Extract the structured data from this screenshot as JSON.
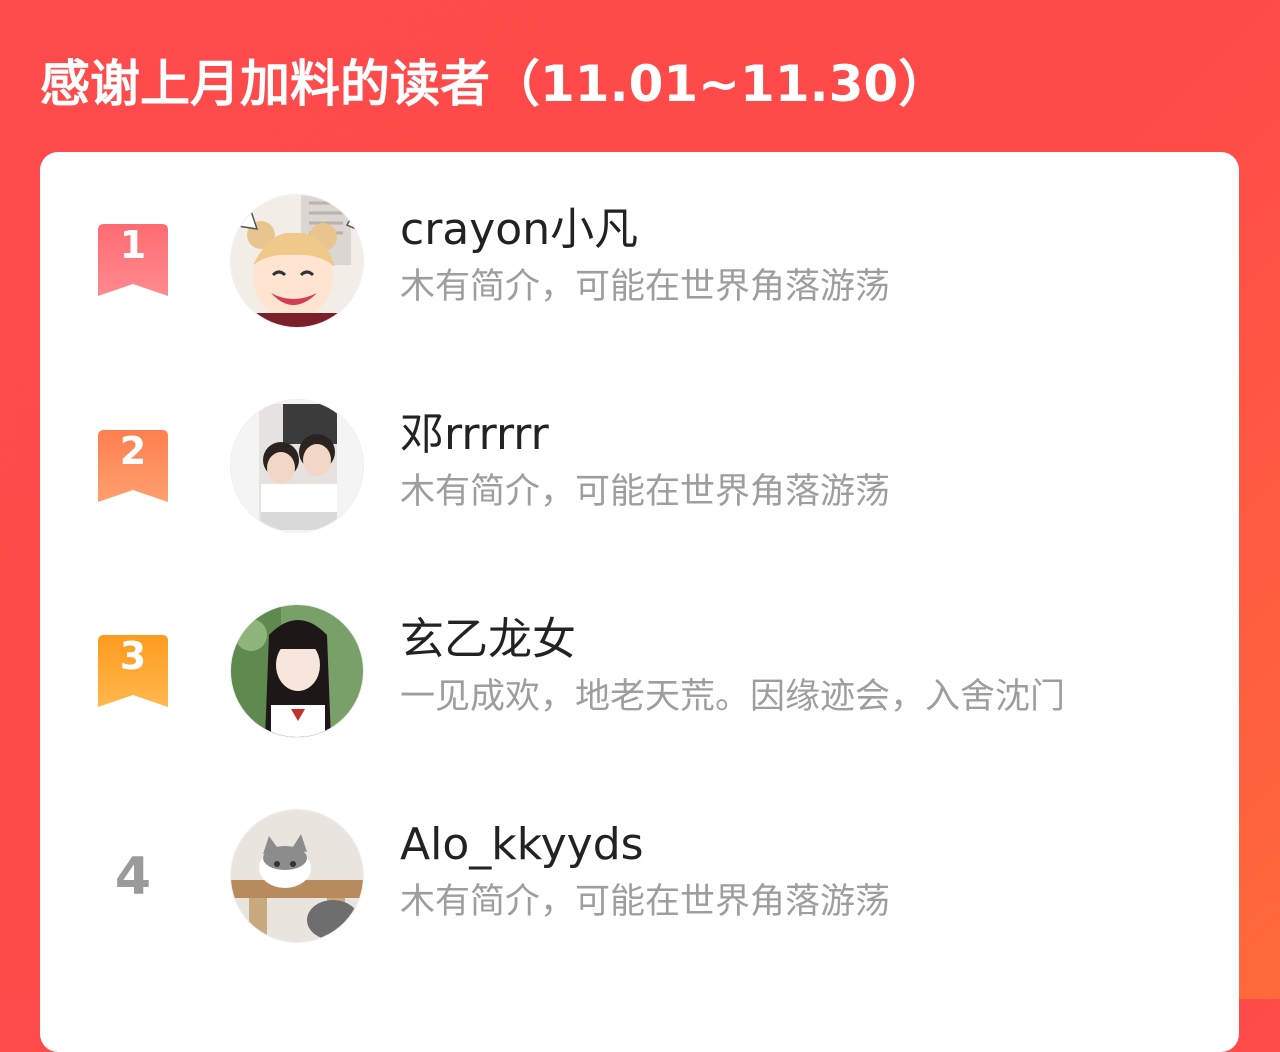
{
  "header": {
    "title": "感谢上月加料的读者（11.01~11.30）"
  },
  "colors": {
    "background": "#ff4a4a",
    "rank1": "#ff5a5f",
    "rank2": "#ff7a45",
    "rank3": "#ff9a1f",
    "rank_plain": "#9a9a9a"
  },
  "readers": [
    {
      "rank": "1",
      "name": "crayon小凡",
      "bio": "木有简介，可能在世界角落游荡",
      "avatar_icon": "anime-girl-avatar"
    },
    {
      "rank": "2",
      "name": "邓rrrrrr",
      "bio": "木有简介，可能在世界角落游荡",
      "avatar_icon": "two-girls-photo-avatar"
    },
    {
      "rank": "3",
      "name": "玄乙龙女",
      "bio": "一见成欢，地老天荒。因缘迹会，入舍沈门",
      "avatar_icon": "girl-portrait-avatar"
    },
    {
      "rank": "4",
      "name": "Alo_kkyyds",
      "bio": "木有简介，可能在世界角落游荡",
      "avatar_icon": "cat-photo-avatar"
    }
  ]
}
